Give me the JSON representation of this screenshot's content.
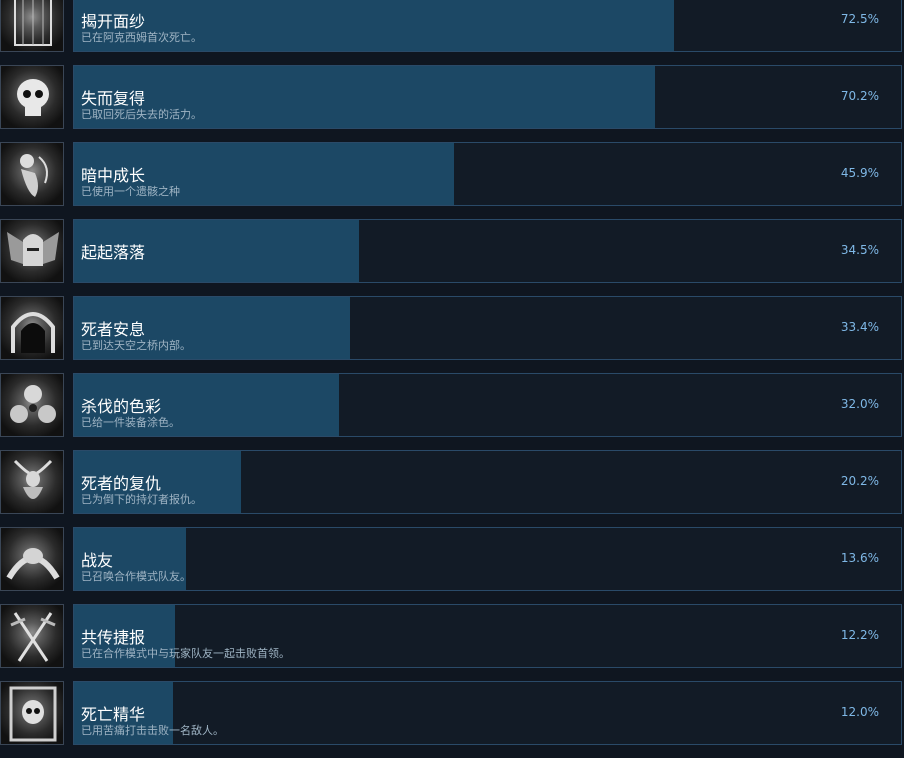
{
  "achievements": [
    {
      "title": "揭开面纱",
      "desc": "已在阿克西姆首次死亡。",
      "pct_label": "72.5%",
      "pct": 72.5,
      "icon": "cage-icon"
    },
    {
      "title": "失而复得",
      "desc": "已取回死后失去的活力。",
      "pct_label": "70.2%",
      "pct": 70.2,
      "icon": "skull-icon"
    },
    {
      "title": "暗中成长",
      "desc": "已使用一个遗骸之种",
      "pct_label": "45.9%",
      "pct": 45.9,
      "icon": "seed-icon"
    },
    {
      "title": "起起落落",
      "desc": "",
      "pct_label": "34.5%",
      "pct": 34.5,
      "icon": "winged-helmet-icon"
    },
    {
      "title": "死者安息",
      "desc": "已到达天空之桥内部。",
      "pct_label": "33.4%",
      "pct": 33.4,
      "icon": "arch-icon"
    },
    {
      "title": "杀伐的色彩",
      "desc": "已给一件装备涂色。",
      "pct_label": "32.0%",
      "pct": 32.0,
      "icon": "paint-orbs-icon"
    },
    {
      "title": "死者的复仇",
      "desc": "已为倒下的持灯者报仇。",
      "pct_label": "20.2%",
      "pct": 20.2,
      "icon": "horned-figure-icon"
    },
    {
      "title": "战友",
      "desc": "已召唤合作模式队友。",
      "pct_label": "13.6%",
      "pct": 13.6,
      "icon": "clasped-hands-icon"
    },
    {
      "title": "共传捷报",
      "desc": "已在合作模式中与玩家队友一起击败首领。",
      "pct_label": "12.2%",
      "pct": 12.2,
      "icon": "crossed-swords-icon"
    },
    {
      "title": "死亡精华",
      "desc": "已用苦痛打击击败一名敌人。",
      "pct_label": "12.0%",
      "pct": 12.0,
      "icon": "skull-frame-icon"
    }
  ]
}
